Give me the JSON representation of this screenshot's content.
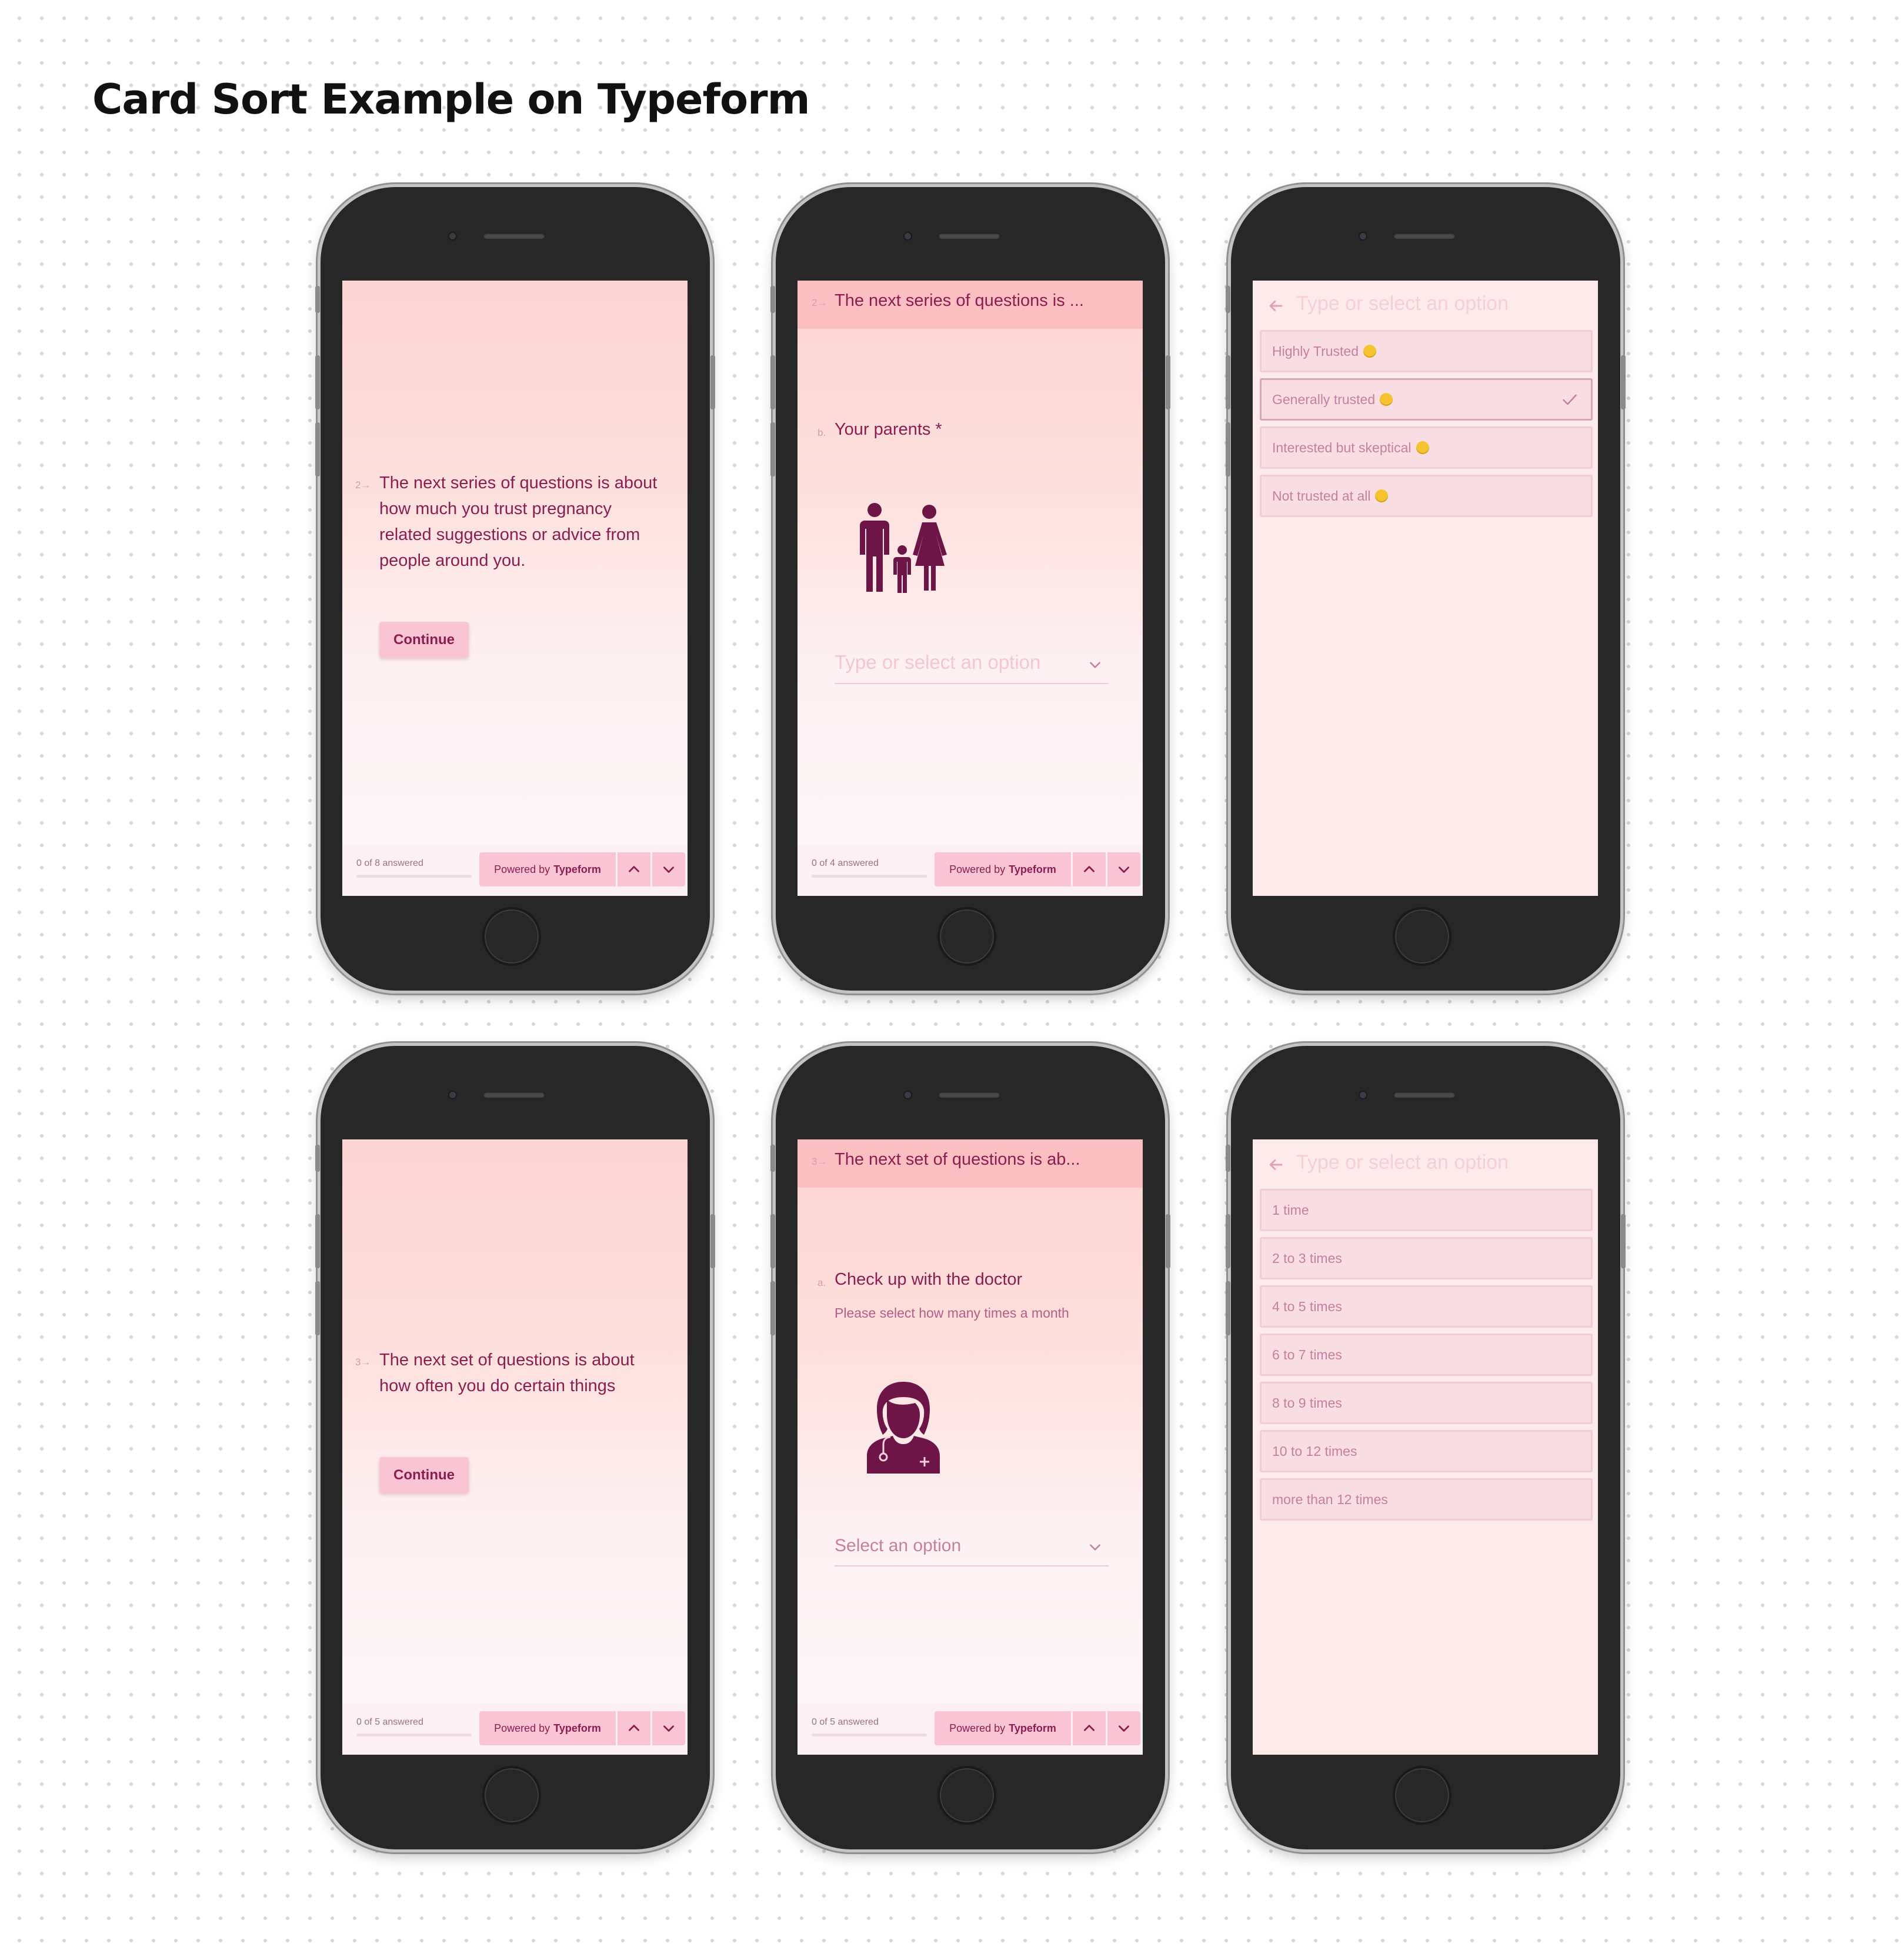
{
  "title": "Card Sort Example on Typeform",
  "common": {
    "powered_prefix": "Powered by",
    "powered_brand": "Typeform",
    "continue_label": "Continue"
  },
  "colors": {
    "accent": "#8c1d50",
    "button_bg": "#f9c4d4",
    "screen_top": "#fcd4d2",
    "screen_bottom": "#fdf8fb",
    "option_bg": "#f8dee3"
  },
  "screens": {
    "s1": {
      "qnum": "2→",
      "text": "The next series of questions is about how much you trust pregnancy related suggestions or advice from people around you.",
      "progress": "0 of 8 answered"
    },
    "s2": {
      "header_num": "2→",
      "header_text": "The next series of questions is ...",
      "question_num": "b.",
      "question_label": "Your parents *",
      "illustration": "family-icon",
      "dropdown_placeholder": "Type or select an option",
      "progress": "0 of 4 answered"
    },
    "s3": {
      "search_placeholder": "Type or select an option",
      "options": [
        {
          "label": "Highly Trusted",
          "emoji": "star-struck-emoji",
          "selected": false
        },
        {
          "label": "Generally trusted",
          "emoji": "smiling-emoji",
          "selected": true
        },
        {
          "label": "Interested but skeptical",
          "emoji": "thinking-emoji",
          "selected": false
        },
        {
          "label": "Not trusted at all",
          "emoji": "crying-laughing-emoji",
          "selected": false
        }
      ]
    },
    "s4": {
      "qnum": "3→",
      "text": "The next set of questions is about how often you do certain things",
      "progress": "0 of 5 answered"
    },
    "s5": {
      "header_num": "3→",
      "header_text": "The next set of questions is ab...",
      "question_num": "a.",
      "question_label": "Check up with the doctor",
      "description": "Please select how many times a month",
      "illustration": "doctor-icon",
      "dropdown_placeholder": "Select an option",
      "progress": "0 of 5 answered"
    },
    "s6": {
      "search_placeholder": "Type or select an option",
      "options": [
        "1 time",
        "2 to 3 times",
        "4 to 5 times",
        "6 to 7 times",
        "8 to 9 times",
        "10 to 12 times",
        "more than 12 times"
      ]
    }
  }
}
